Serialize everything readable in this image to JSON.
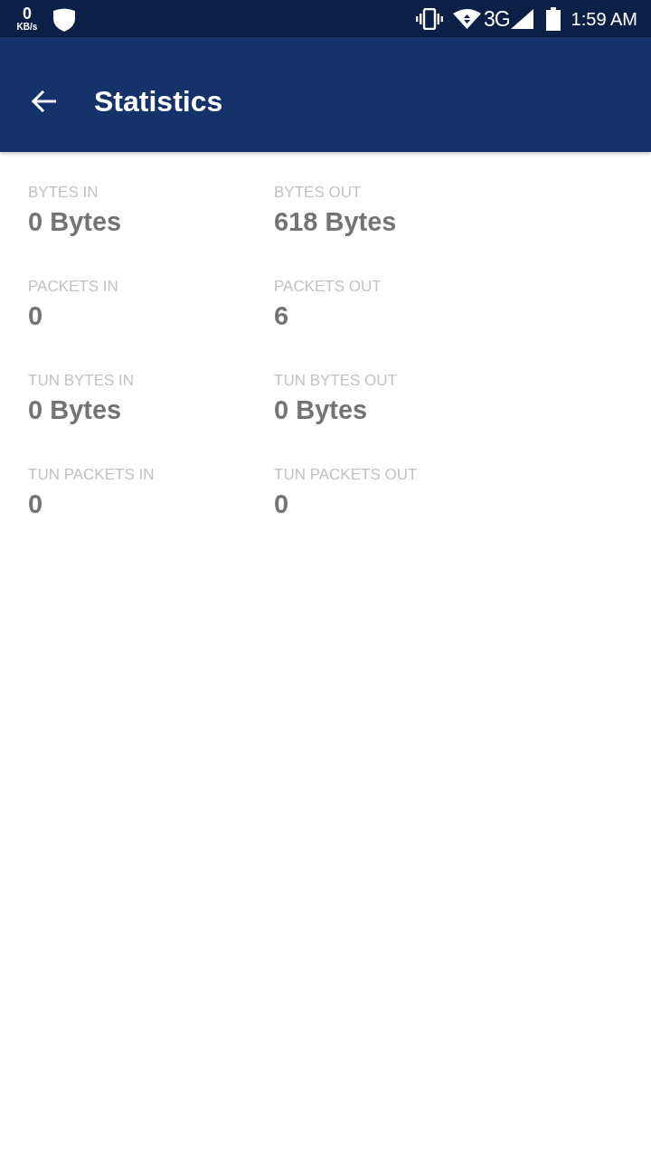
{
  "status_bar": {
    "speed_value": "0",
    "speed_unit": "KB/s",
    "network_type": "3G",
    "time": "1:59 AM"
  },
  "app_bar": {
    "title": "Statistics"
  },
  "stats": [
    {
      "label": "BYTES IN",
      "value": "0 Bytes"
    },
    {
      "label": "BYTES OUT",
      "value": "618 Bytes"
    },
    {
      "label": "PACKETS IN",
      "value": "0"
    },
    {
      "label": "PACKETS OUT",
      "value": "6"
    },
    {
      "label": "TUN BYTES IN",
      "value": "0 Bytes"
    },
    {
      "label": "TUN BYTES OUT",
      "value": "0 Bytes"
    },
    {
      "label": "TUN PACKETS IN",
      "value": "0"
    },
    {
      "label": "TUN PACKETS OUT",
      "value": "0"
    }
  ]
}
